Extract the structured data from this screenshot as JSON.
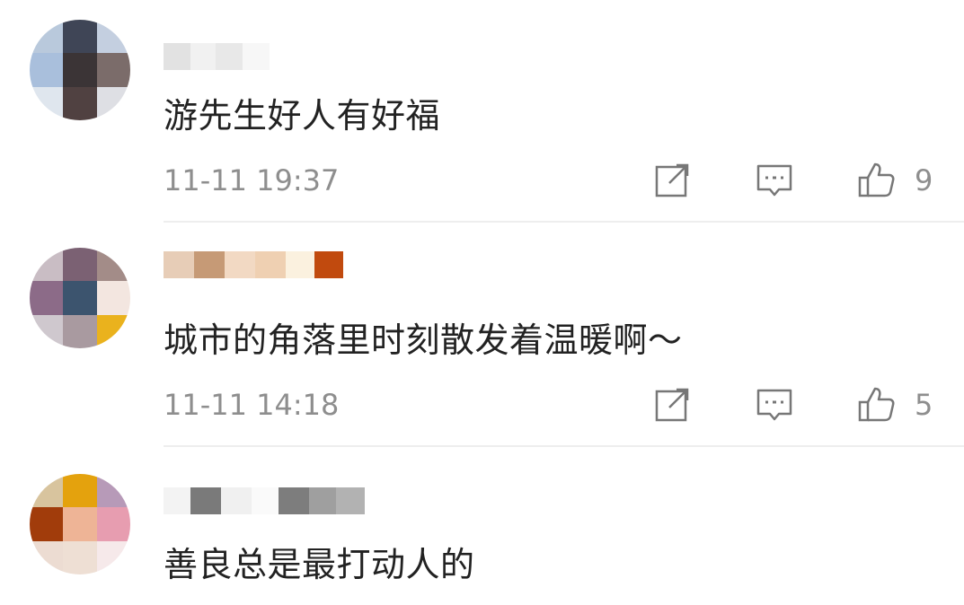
{
  "comments": [
    {
      "text": "游先生好人有好福",
      "time": "11-11 19:37",
      "likes": "9"
    },
    {
      "text": "城市的角落里时刻散发着温暖啊～",
      "time": "11-11 14:18",
      "likes": "5"
    },
    {
      "text": "善良总是最打动人的"
    }
  ],
  "icons": {
    "share": "share-icon",
    "reply": "comment-icon",
    "like": "thumbs-up-icon"
  },
  "colors": {
    "text": "#222222",
    "meta": "#8e8e8e",
    "divider": "#eeeeee"
  }
}
